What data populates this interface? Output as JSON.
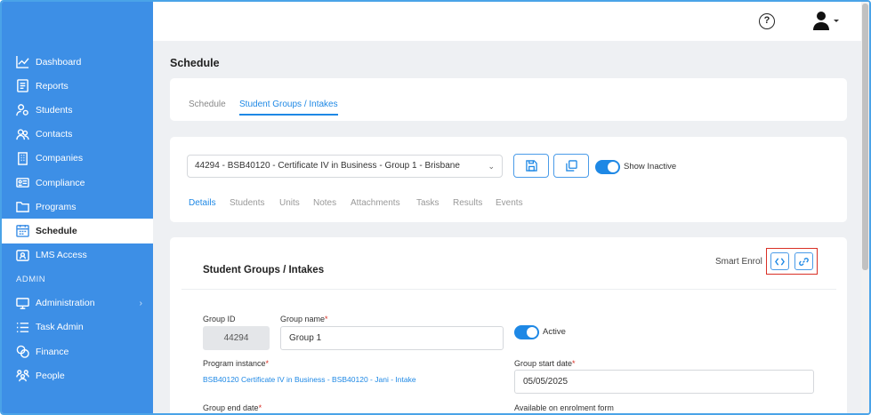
{
  "sidebar": {
    "items": [
      {
        "label": "Dashboard",
        "icon": "chart-line-icon"
      },
      {
        "label": "Reports",
        "icon": "reports-icon"
      },
      {
        "label": "Students",
        "icon": "students-icon"
      },
      {
        "label": "Contacts",
        "icon": "contacts-icon"
      },
      {
        "label": "Companies",
        "icon": "building-icon"
      },
      {
        "label": "Compliance",
        "icon": "id-card-icon"
      },
      {
        "label": "Programs",
        "icon": "folder-icon"
      },
      {
        "label": "Schedule",
        "icon": "calendar-icon",
        "active": true
      },
      {
        "label": "LMS Access",
        "icon": "lms-icon"
      }
    ],
    "admin_heading": "ADMIN",
    "admin_items": [
      {
        "label": "Administration",
        "icon": "monitor-icon",
        "has_submenu": true
      },
      {
        "label": "Task Admin",
        "icon": "list-icon"
      },
      {
        "label": "Finance",
        "icon": "coins-icon"
      },
      {
        "label": "People",
        "icon": "people-icon"
      }
    ]
  },
  "header": {
    "help_icon": "?",
    "user_icon": "user-avatar-icon"
  },
  "main": {
    "page_title": "Schedule",
    "top_tabs": [
      {
        "label": "Schedule",
        "active": false
      },
      {
        "label": "Student Groups / Intakes",
        "active": true
      }
    ],
    "group_select": {
      "value": "44294 - BSB40120 - Certificate IV in Business - Group 1 - Brisbane"
    },
    "show_inactive_label": "Show Inactive",
    "sub_tabs": [
      {
        "label": "Details",
        "active": true
      },
      {
        "label": "Students"
      },
      {
        "label": "Units"
      },
      {
        "label": "Notes"
      },
      {
        "label": "Attachments"
      },
      {
        "label": "Tasks"
      },
      {
        "label": "Results"
      },
      {
        "label": "Events"
      }
    ],
    "section_title": "Student Groups / Intakes",
    "smart_enrol_label": "Smart Enrol",
    "form": {
      "group_id_label": "Group ID",
      "group_id_value": "44294",
      "group_name_label": "Group name",
      "group_name_value": "Group 1",
      "active_label": "Active",
      "program_instance_label": "Program instance",
      "program_instance_value": "BSB40120 Certificate IV in Business - BSB40120 - Jani - Intake",
      "group_start_label": "Group start date",
      "group_start_value": "05/05/2025",
      "group_end_label": "Group end date",
      "enrolment_form_label": "Available on enrolment form",
      "required_mark": "*"
    }
  },
  "colors": {
    "sidebar": "#3d8fe6",
    "accent": "#1e88e5",
    "highlight": "#d93025"
  }
}
